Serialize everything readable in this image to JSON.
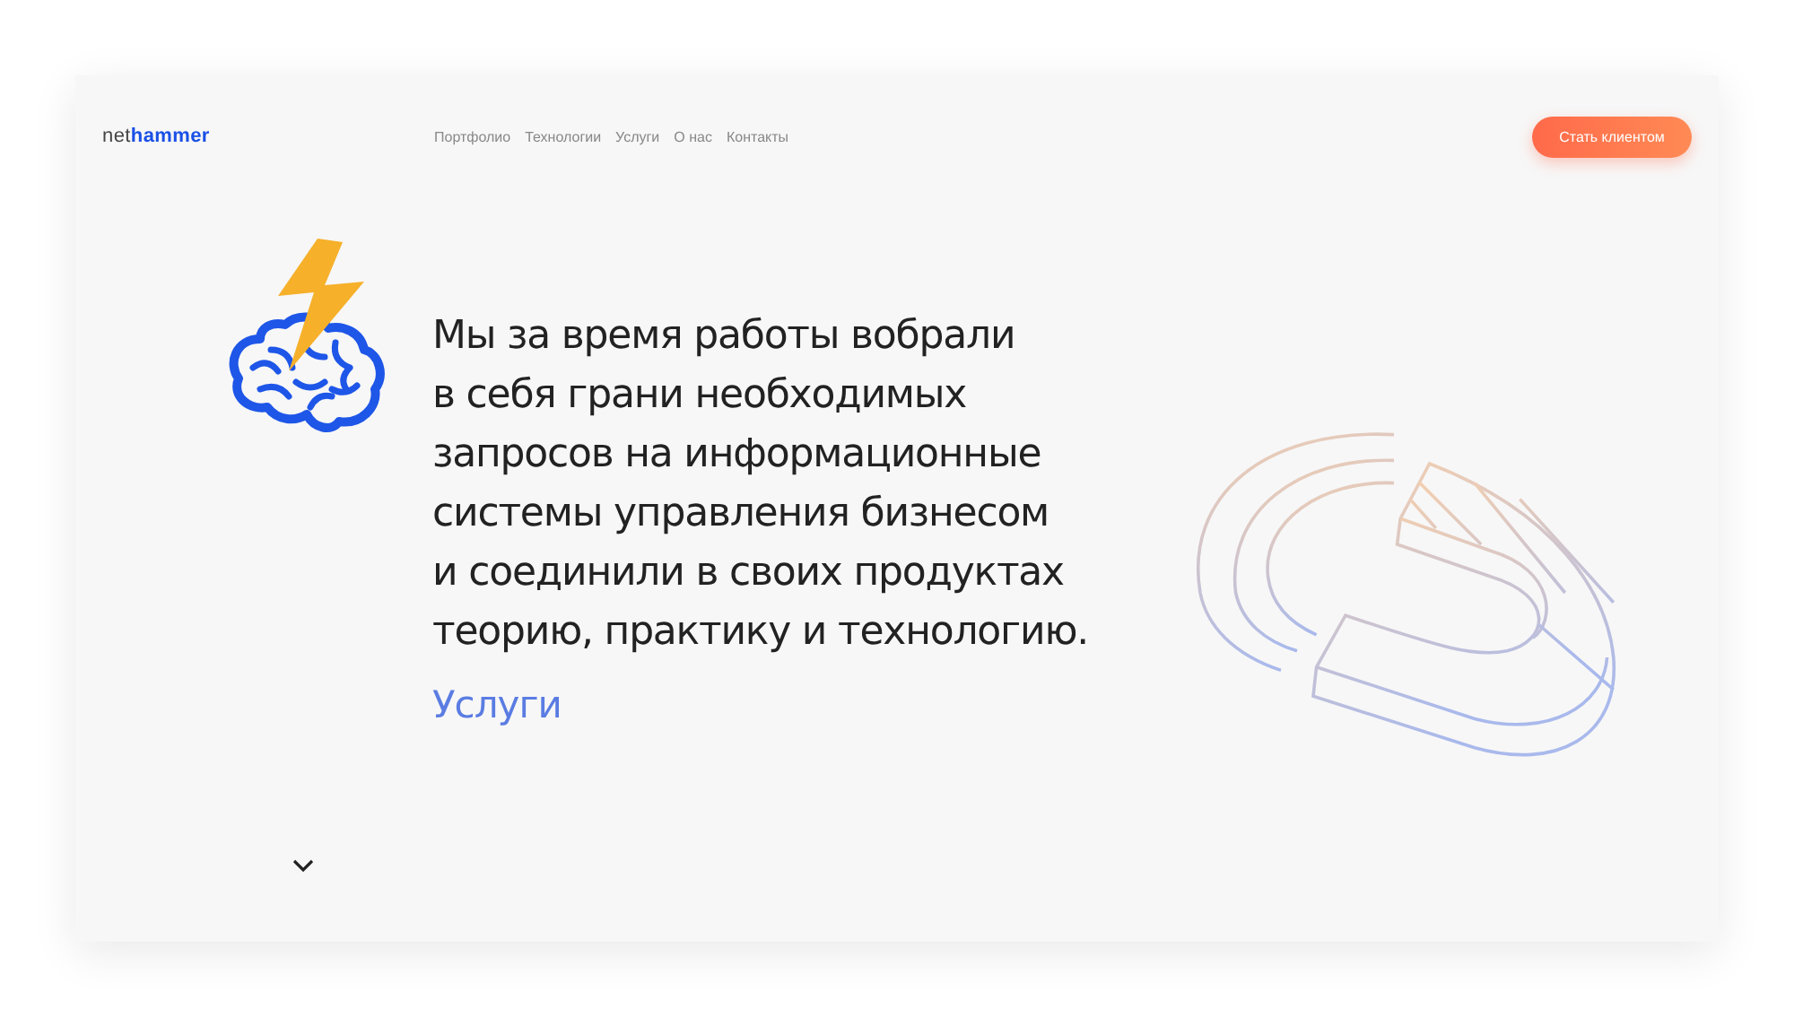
{
  "header": {
    "logo": {
      "part_1": "net",
      "part_2": "hammer"
    },
    "nav": [
      {
        "label": "Портфолио"
      },
      {
        "label": "Технологии"
      },
      {
        "label": "Услуги"
      },
      {
        "label": "О нас"
      },
      {
        "label": "Контакты"
      }
    ],
    "cta_button": "Стать клиентом"
  },
  "hero": {
    "text": "Мы за время работы вобрали\nв себя грани необходимых\nзапросов на информационные\nсистемы управления бизнесом\nи соединили в своих продуктах\nтеорию, практику и технологию.",
    "link": "Услуги"
  }
}
